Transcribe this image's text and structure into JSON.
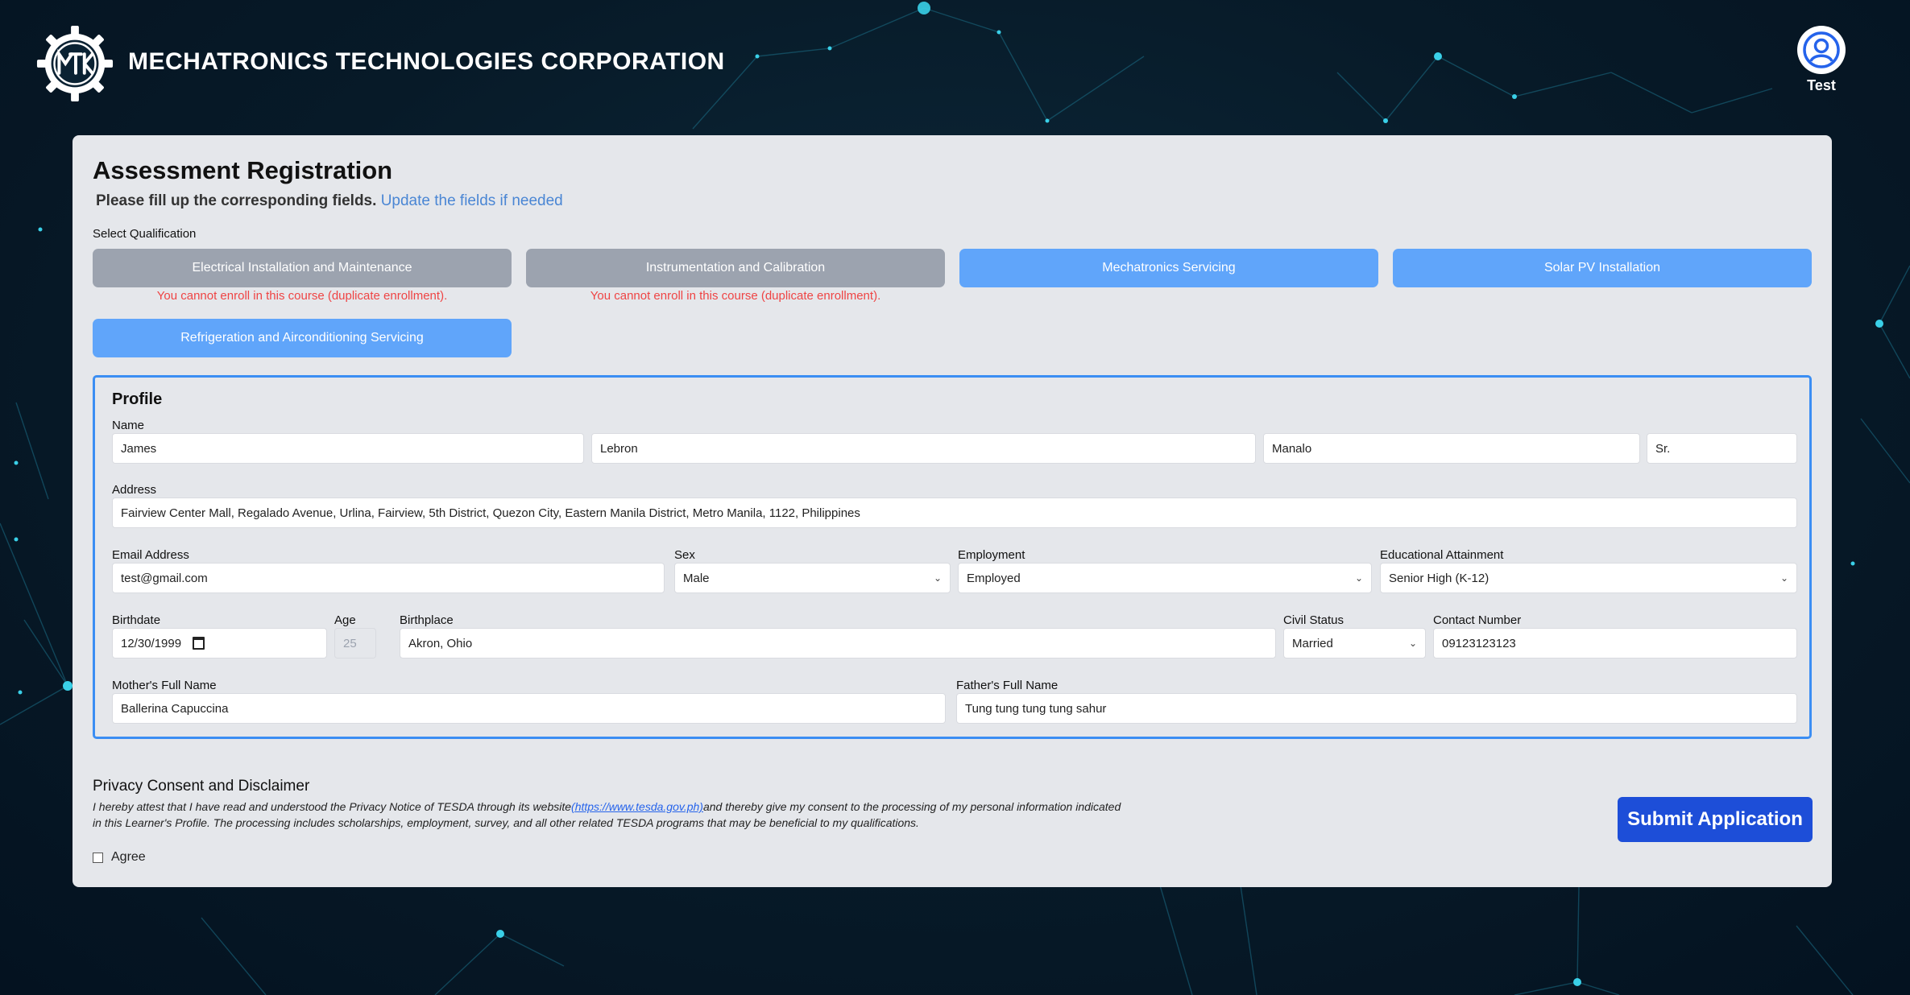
{
  "header": {
    "brand": "MECHATRONICS TECHNOLOGIES CORPORATION",
    "user_name": "Test"
  },
  "form": {
    "title": "Assessment Registration",
    "subtitle_strong": "Please fill up the corresponding fields.",
    "subtitle_link": "Update the fields if needed",
    "select_label": "Select Qualification"
  },
  "qualifications": [
    {
      "label": "Electrical Installation and Maintenance",
      "state": "disabled",
      "error": "You cannot enroll in this course (duplicate enrollment)."
    },
    {
      "label": "Instrumentation and Calibration",
      "state": "disabled",
      "error": "You cannot enroll in this course (duplicate enrollment)."
    },
    {
      "label": "Mechatronics Servicing",
      "state": "available"
    },
    {
      "label": "Solar PV Installation",
      "state": "available"
    },
    {
      "label": "Refrigeration and Airconditioning Servicing",
      "state": "available"
    }
  ],
  "profile": {
    "title": "Profile",
    "labels": {
      "name": "Name",
      "address": "Address",
      "email": "Email Address",
      "sex": "Sex",
      "employment": "Employment",
      "education": "Educational Attainment",
      "birthdate": "Birthdate",
      "age": "Age",
      "birthplace": "Birthplace",
      "civil_status": "Civil Status",
      "contact": "Contact Number",
      "mother": "Mother's Full Name",
      "father": "Father's Full Name"
    },
    "values": {
      "first_name": "James",
      "middle_name": "Lebron",
      "last_name": "Manalo",
      "suffix": "Sr.",
      "address": "Fairview Center Mall, Regalado Avenue, Urlina, Fairview, 5th District, Quezon City, Eastern Manila District, Metro Manila, 1122, Philippines",
      "email": "test@gmail.com",
      "sex": "Male",
      "employment": "Employed",
      "education": "Senior High (K-12)",
      "birthdate": "12/30/1999",
      "age": "25",
      "birthplace": "Akron, Ohio",
      "civil_status": "Married",
      "contact": "09123123123",
      "mother": "Ballerina Capuccina",
      "father": "Tung tung tung tung sahur"
    }
  },
  "privacy": {
    "title": "Privacy Consent and Disclaimer",
    "text_before": "I hereby attest that I have read and understood the Privacy Notice of TESDA through its website",
    "link": "(https://www.tesda.gov.ph)",
    "text_after": "and thereby give my consent to the processing of my personal information indicated in this Learner's Profile. The processing includes scholarships, employment, survey, and all other related TESDA programs that may be beneficial to my qualifications.",
    "agree_label": "Agree"
  },
  "submit_label": "Submit Application",
  "colors": {
    "primary": "#1d4ed8",
    "available": "#60a5fa",
    "disabled": "#9ca3af",
    "error": "#ef4444",
    "card": "#e5e7eb"
  }
}
